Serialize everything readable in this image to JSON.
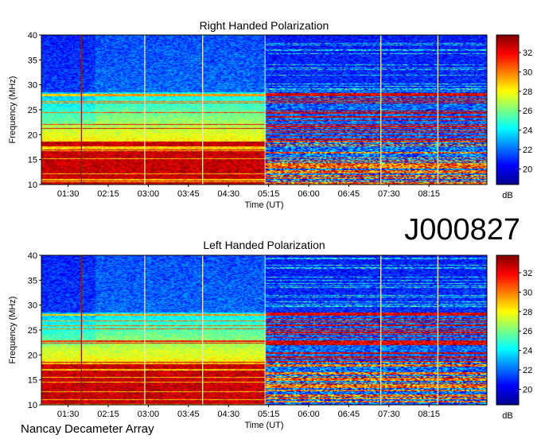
{
  "figure": {
    "observation_id": "J000827",
    "instrument": "Nancay Decameter Array"
  },
  "chart_data": [
    {
      "type": "heatmap",
      "title": "Right Handed Polarization",
      "xlabel": "Time (UT)",
      "ylabel": "Frequency (MHz)",
      "x_tick_labels": [
        "01:30",
        "02:15",
        "03:00",
        "03:45",
        "04:30",
        "05:15",
        "06:00",
        "06:45",
        "07:30",
        "08:15"
      ],
      "x_range_minutes": [
        60,
        560
      ],
      "x_tick_minutes": [
        90,
        135,
        180,
        225,
        270,
        315,
        360,
        405,
        450,
        495
      ],
      "y_ticks": [
        10,
        15,
        20,
        25,
        30,
        35,
        40
      ],
      "ylim": [
        10,
        40
      ],
      "colorbar": {
        "label": "dB",
        "ticks": [
          20,
          22,
          24,
          26,
          28,
          30,
          32
        ],
        "range": [
          18.4,
          33.8
        ]
      },
      "vertical_markers_minutes": [
        105,
        176,
        241,
        441,
        505
      ],
      "marker_color_first": "#8b1a1a",
      "marker_color": "#f2e8b0",
      "mode_switch_minutes": 311,
      "colormap": [
        "#00008f",
        "#0000ff",
        "#0080ff",
        "#00ffff",
        "#80ff80",
        "#ffff00",
        "#ff8000",
        "#ff0000",
        "#800000"
      ]
    },
    {
      "type": "heatmap",
      "title": "Left Handed Polarization",
      "xlabel": "Time (UT)",
      "ylabel": "Frequency (MHz)",
      "x_tick_labels": [
        "01:30",
        "02:15",
        "03:00",
        "03:45",
        "04:30",
        "05:15",
        "06:00",
        "06:45",
        "07:30",
        "08:15"
      ],
      "x_range_minutes": [
        60,
        560
      ],
      "x_tick_minutes": [
        90,
        135,
        180,
        225,
        270,
        315,
        360,
        405,
        450,
        495
      ],
      "y_ticks": [
        10,
        15,
        20,
        25,
        30,
        35,
        40
      ],
      "ylim": [
        10,
        40
      ],
      "colorbar": {
        "label": "dB",
        "ticks": [
          20,
          22,
          24,
          26,
          28,
          30,
          32
        ],
        "range": [
          18.4,
          33.8
        ]
      },
      "vertical_markers_minutes": [
        105,
        176,
        241,
        441,
        505
      ],
      "marker_color_first": "#8b1a1a",
      "marker_color": "#f2e8b0",
      "mode_switch_minutes": 311,
      "colormap": [
        "#00008f",
        "#0000ff",
        "#0080ff",
        "#00ffff",
        "#80ff80",
        "#ffff00",
        "#ff8000",
        "#ff0000",
        "#800000"
      ]
    }
  ]
}
